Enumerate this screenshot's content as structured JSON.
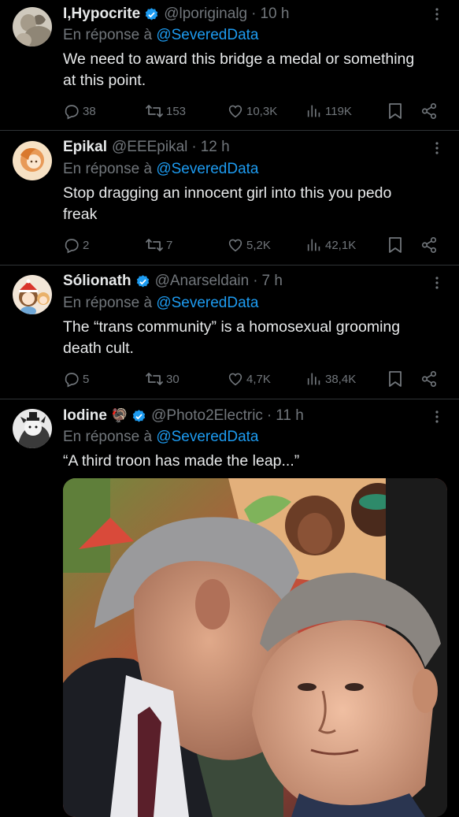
{
  "colors": {
    "background": "#000000",
    "text_primary": "#e7e9ea",
    "text_secondary": "#71767b",
    "link": "#1d9bf0",
    "verified": "#1d9bf0",
    "divider": "#2f3336"
  },
  "reply_prefix": "En réponse à",
  "tweets": [
    {
      "name": "I,Hypocrite",
      "verified": true,
      "handle": "@lporiginalg",
      "time": "10 h",
      "reply_to": "@SeveredData",
      "text_lines": [
        "We need to award this bridge a medal or something",
        "at this point."
      ],
      "replies": "38",
      "retweets": "153",
      "likes": "10,3K",
      "views": "119K"
    },
    {
      "name": "Epikal",
      "verified": false,
      "handle": "@EEEpikal",
      "time": "12 h",
      "reply_to": "@SeveredData",
      "text_lines": [
        "Stop dragging an innocent girl into this you pedo",
        "freak"
      ],
      "replies": "2",
      "retweets": "7",
      "likes": "5,2K",
      "views": "42,1K"
    },
    {
      "name": "Sólionath",
      "verified": true,
      "handle": "@Anarseldain",
      "time": "7 h",
      "reply_to": "@SeveredData",
      "text_lines": [
        "The “trans community” is a homosexual grooming",
        "death cult."
      ],
      "replies": "5",
      "retweets": "30",
      "likes": "4,7K",
      "views": "38,4K"
    },
    {
      "name": "Iodine",
      "emoji": "🦃",
      "verified": true,
      "handle": "@Photo2Electric",
      "time": "11 h",
      "reply_to": "@SeveredData",
      "text_lines": [
        "“A third troon has made the leap...”"
      ]
    }
  ],
  "icons": [
    "more-icon",
    "verified-badge-icon",
    "reply-icon",
    "retweet-icon",
    "like-icon",
    "views-icon",
    "bookmark-icon",
    "share-icon"
  ]
}
